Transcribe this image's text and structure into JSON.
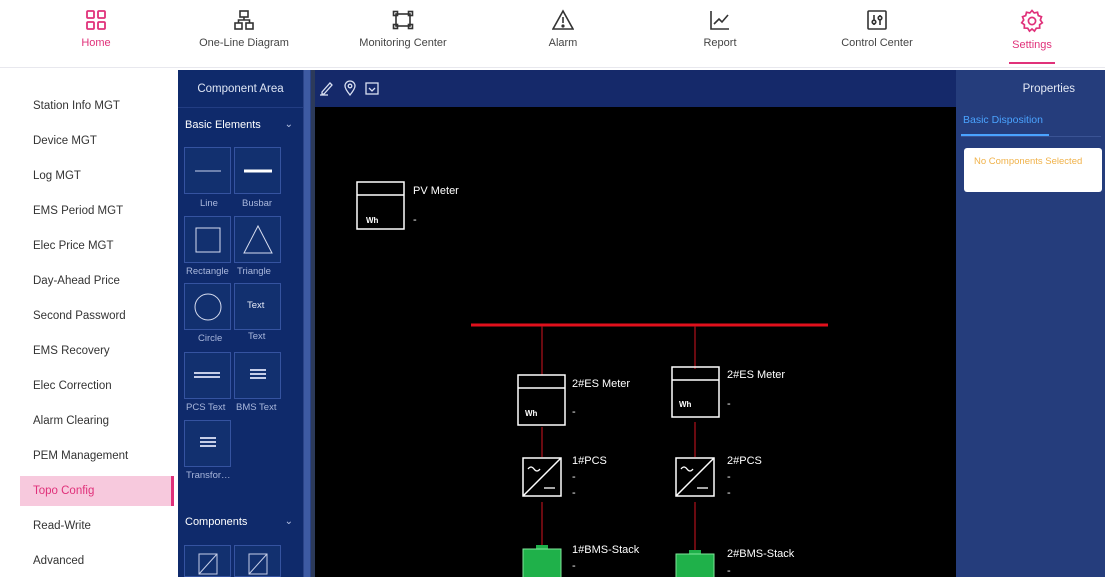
{
  "topnav": {
    "items": [
      {
        "label": "Home",
        "icon": "grid-icon"
      },
      {
        "label": "One-Line Diagram",
        "icon": "hierarchy-icon"
      },
      {
        "label": "Monitoring Center",
        "icon": "monitor-frame-icon"
      },
      {
        "label": "Alarm",
        "icon": "warning-triangle-icon"
      },
      {
        "label": "Report",
        "icon": "line-chart-icon"
      },
      {
        "label": "Control Center",
        "icon": "sliders-icon"
      },
      {
        "label": "Settings",
        "icon": "gear-icon"
      }
    ],
    "active": "Settings",
    "accent_color": "#e0317a"
  },
  "sidebar": {
    "items": [
      {
        "label": "Station Info MGT"
      },
      {
        "label": "Device MGT"
      },
      {
        "label": "Log MGT"
      },
      {
        "label": "EMS Period MGT"
      },
      {
        "label": "Elec Price MGT"
      },
      {
        "label": "Day-Ahead Price"
      },
      {
        "label": "Second Password"
      },
      {
        "label": "EMS Recovery"
      },
      {
        "label": "Elec Correction"
      },
      {
        "label": "Alarm Clearing"
      },
      {
        "label": "PEM Management"
      },
      {
        "label": "Topo Config"
      },
      {
        "label": "Read-Write"
      },
      {
        "label": "Advanced"
      }
    ],
    "active": "Topo Config"
  },
  "component_area": {
    "title": "Component Area",
    "basic_section": "Basic Elements",
    "components_section": "Components",
    "tiles": [
      {
        "label": "Line",
        "icon": "line-icon"
      },
      {
        "label": "Busbar",
        "icon": "busbar-icon"
      },
      {
        "label": "Rectangle",
        "icon": "rectangle-icon"
      },
      {
        "label": "Triangle",
        "icon": "triangle-icon"
      },
      {
        "label": "Circle",
        "icon": "circle-icon"
      },
      {
        "label": "Text",
        "icon": "text-icon",
        "glyph": "Text"
      },
      {
        "label": "PCS Text",
        "icon": "pcs-text-icon"
      },
      {
        "label": "BMS Text",
        "icon": "bms-text-icon"
      },
      {
        "label": "Transfor…",
        "icon": "transformer-text-icon"
      }
    ]
  },
  "toolbar": {
    "icons": [
      "pen-icon",
      "location-pin-icon",
      "folder-icon"
    ]
  },
  "diagram": {
    "pv_meter": {
      "name": "PV Meter",
      "unit": "Wh",
      "value": "-"
    },
    "es_meter_1": {
      "name": "2#ES Meter",
      "unit": "Wh",
      "value": "-"
    },
    "es_meter_2": {
      "name": "2#ES Meter",
      "unit": "Wh",
      "value": "-"
    },
    "pcs_1": {
      "name": "1#PCS",
      "value1": "-",
      "value2": "-"
    },
    "pcs_2": {
      "name": "2#PCS",
      "value1": "-",
      "value2": "-"
    },
    "bms_1": {
      "name": "1#BMS-Stack",
      "value": "-"
    },
    "bms_2": {
      "name": "2#BMS-Stack",
      "value": "-"
    },
    "busbar_color": "#e0101c",
    "line_color": "#b0101a",
    "battery_color": "#1fb14a"
  },
  "properties": {
    "title": "Properties",
    "tab": "Basic Disposition",
    "empty_message": "No Components Selected"
  }
}
